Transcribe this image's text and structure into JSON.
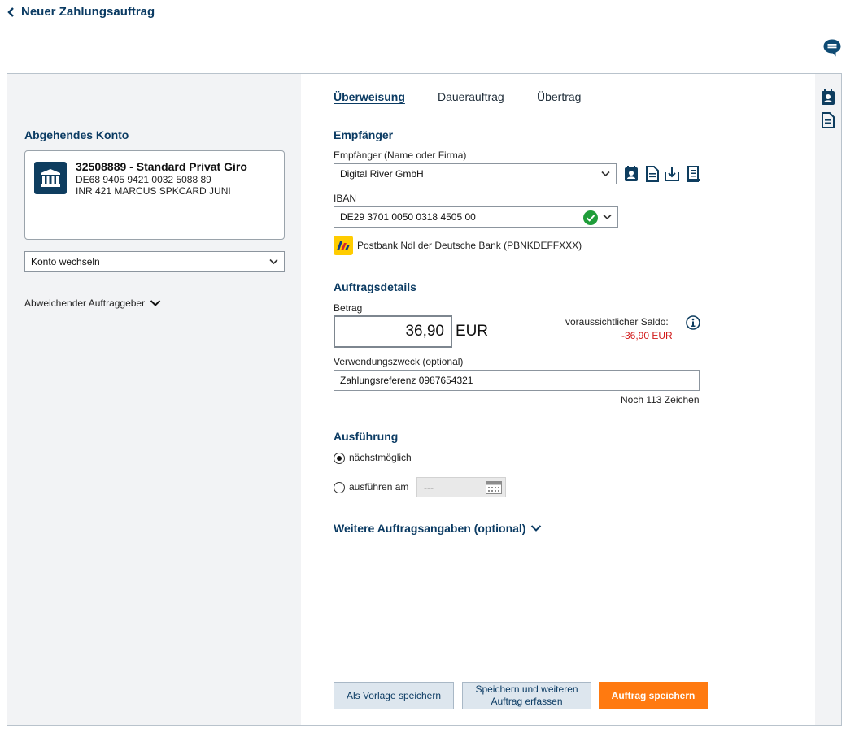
{
  "header": {
    "title": "Neuer Zahlungsauftrag",
    "back_icon": "chevron-left-icon",
    "chat_icon": "chat-bubble-icon"
  },
  "source_account": {
    "section_title": "Abgehendes Konto",
    "icon": "bank-icon",
    "name": "32508889 - Standard Privat Giro",
    "iban": "DE68 9405 9421 0032 5088 89",
    "description": "INR 421 MARCUS SPKCARD JUNI",
    "switch_label": "Konto wechseln",
    "other_originator_label": "Abweichender Auftraggeber"
  },
  "tabs": [
    {
      "label": "Überweisung",
      "active": true
    },
    {
      "label": "Dauerauftrag",
      "active": false
    },
    {
      "label": "Übertrag",
      "active": false
    }
  ],
  "recipient": {
    "section_title": "Empfänger",
    "name_label": "Empfänger (Name oder Firma)",
    "name_value": "Digital River GmbH",
    "iban_label": "IBAN",
    "iban_value": "DE29 3701 0050 0318 4505 00",
    "iban_valid": true,
    "bank_name": "Postbank Ndl der Deutsche Bank",
    "bic": "(PBNKDEFFXXX)",
    "tool_icons": [
      "contact-book-icon",
      "document-icon",
      "download-icon",
      "receipt-icon"
    ]
  },
  "order_details": {
    "section_title": "Auftragsdetails",
    "amount_label": "Betrag",
    "amount_value": "36,90",
    "currency": "EUR",
    "balance_label": "voraussichtlicher Saldo:",
    "balance_value": "-36,90 EUR",
    "purpose_label": "Verwendungszweck (optional)",
    "purpose_value": "Zahlungsreferenz 0987654321",
    "chars_left": "Noch 113 Zeichen"
  },
  "execution": {
    "section_title": "Ausführung",
    "option_asap": "nächstmöglich",
    "option_date": "ausführen am",
    "selected": "asap",
    "date_placeholder": "---"
  },
  "more_details": {
    "label": "Weitere Auftragsangaben (optional)"
  },
  "buttons": {
    "save_template": "Als Vorlage speichern",
    "save_and_new_line1": "Speichern und weiteren",
    "save_and_new_line2": "Auftrag erfassen",
    "save_order": "Auftrag speichern"
  },
  "colors": {
    "brand": "#0b3b63",
    "accent": "#ff7a10",
    "negative": "#d11a1a",
    "valid": "#1f9d3a"
  }
}
